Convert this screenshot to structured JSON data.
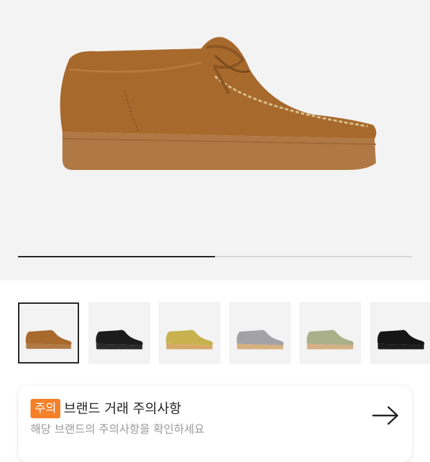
{
  "gallery": {
    "progress_fraction": 0.5,
    "main_image_icon": "tan-suede-wallabee-shoe"
  },
  "thumbnails": [
    {
      "color": "#a8692d",
      "sole": "#b07a45",
      "selected": true
    },
    {
      "color": "#1c1c1c",
      "sole": "#2a2a2a",
      "selected": false
    },
    {
      "color": "#c7b24f",
      "sole": "#d6a968",
      "selected": false
    },
    {
      "color": "#a3a3a6",
      "sole": "#d6b07e",
      "selected": false
    },
    {
      "color": "#a9b08a",
      "sole": "#d4b085",
      "selected": false
    },
    {
      "color": "#151515",
      "sole": "#1c1c1c",
      "selected": false
    }
  ],
  "notice": {
    "badge": "주의",
    "title": "브랜드 거래 주의사항",
    "subtitle": "해당 브랜드의 주의사항을 확인하세요",
    "arrow_icon": "arrow-right-icon"
  },
  "colors": {
    "accent": "#f5802a",
    "shoe_main": "#a8692d"
  }
}
